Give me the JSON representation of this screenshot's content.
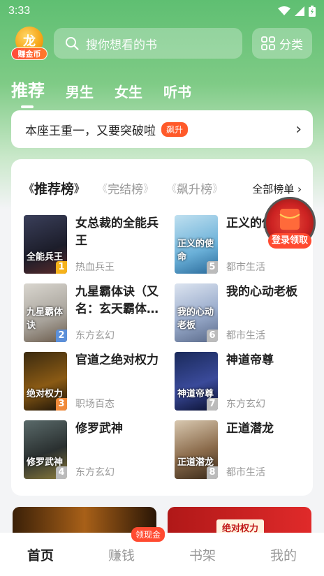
{
  "status": {
    "time": "3:33"
  },
  "header": {
    "coin_label": "赚金币",
    "search_placeholder": "搜你想看的书",
    "category_label": "分类"
  },
  "tabs": [
    {
      "label": "推荐",
      "active": true
    },
    {
      "label": "男生",
      "active": false
    },
    {
      "label": "女生",
      "active": false
    },
    {
      "label": "听书",
      "active": false
    }
  ],
  "notice": {
    "text": "本座王重一，又要突破啦",
    "tag": "飙升"
  },
  "rank": {
    "tabs": [
      {
        "label": "推荐榜",
        "active": true
      },
      {
        "label": "完结榜",
        "active": false
      },
      {
        "label": "飙升榜",
        "active": false
      }
    ],
    "all_label": "全部榜单",
    "books": [
      {
        "rank": "1",
        "title": "女总裁的全能兵王",
        "genre": "热血兵王",
        "cover_text": "全能兵王"
      },
      {
        "rank": "2",
        "title": "九星霸体诀（又名：玄天霸体…",
        "genre": "东方玄幻",
        "cover_text": "九星霸体诀"
      },
      {
        "rank": "3",
        "title": "官道之绝对权力",
        "genre": "职场百态",
        "cover_text": "绝对权力"
      },
      {
        "rank": "4",
        "title": "修罗武神",
        "genre": "东方玄幻",
        "cover_text": "修罗武神"
      },
      {
        "rank": "5",
        "title": "正义的使",
        "genre": "都市生活",
        "cover_text": "正义的使命"
      },
      {
        "rank": "6",
        "title": "我的心动老板",
        "genre": "都市生活",
        "cover_text": "我的心动老板"
      },
      {
        "rank": "7",
        "title": "神道帝尊",
        "genre": "东方玄幻",
        "cover_text": "神道帝尊"
      },
      {
        "rank": "8",
        "title": "正道潜龙",
        "genre": "都市生活",
        "cover_text": "正道潜龙"
      }
    ]
  },
  "login_float": {
    "label": "登录领取"
  },
  "banner": {
    "right_text": "绝对权力"
  },
  "bottom_nav": {
    "items": [
      {
        "label": "首页",
        "active": true
      },
      {
        "label": "赚钱",
        "active": false
      },
      {
        "label": "书架",
        "active": false
      },
      {
        "label": "我的",
        "active": false
      }
    ],
    "badge": "领现金"
  },
  "colors": {
    "brand_green": "#5fbf72",
    "accent_red": "#ff4a30",
    "rank_gold": "#f5b21b",
    "rank_blue": "#5b8fd9",
    "rank_orange": "#f08a3a",
    "rank_gray": "#bbbbbb"
  }
}
